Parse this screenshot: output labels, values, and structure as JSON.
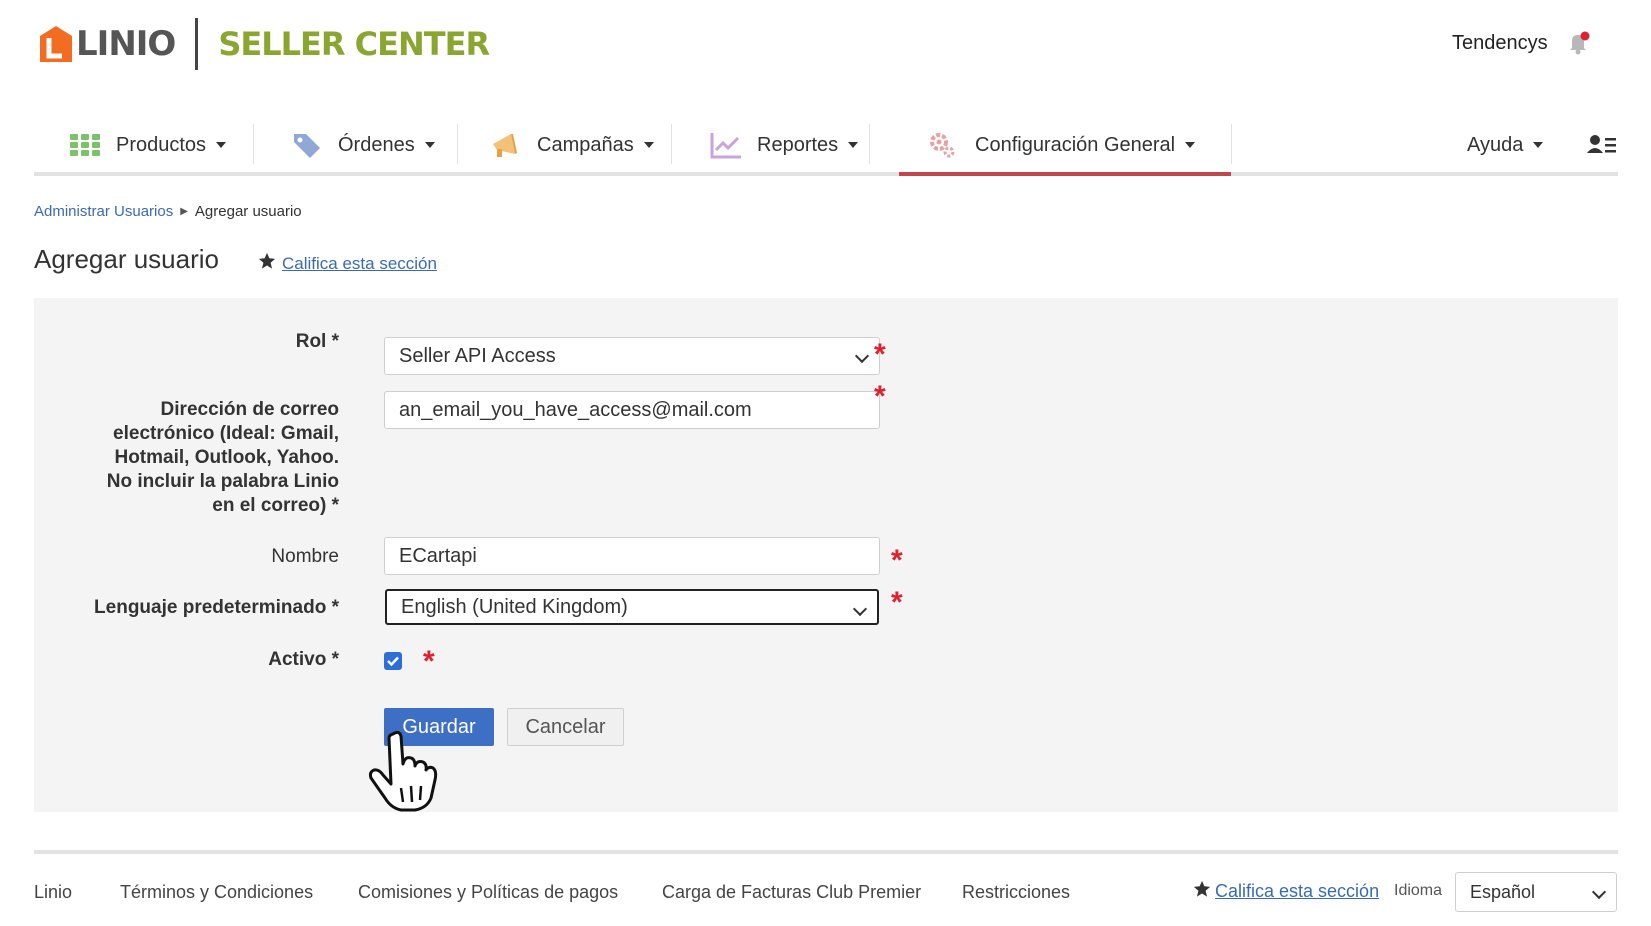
{
  "header": {
    "logo_text": "LINIO",
    "product_name": "SELLER CENTER",
    "user_name": "Tendencys",
    "brand_orange": "#f26c22",
    "brand_green": "#8ba531"
  },
  "nav": {
    "items": [
      {
        "label": "Productos",
        "icon": "grid-icon"
      },
      {
        "label": "Órdenes",
        "icon": "tag-icon"
      },
      {
        "label": "Campañas",
        "icon": "megaphone-icon"
      },
      {
        "label": "Reportes",
        "icon": "chart-icon"
      },
      {
        "label": "Configuración General",
        "icon": "gear-icon",
        "active": true
      }
    ],
    "help_label": "Ayuda",
    "active_color": "#c0474d"
  },
  "breadcrumb": {
    "parent": "Administrar Usuarios",
    "current": "Agregar usuario"
  },
  "page": {
    "title": "Agregar usuario",
    "rate_label": "Califica esta sección"
  },
  "form": {
    "role_label": "Rol *",
    "role_value": "Seller API Access",
    "email_label_lines": [
      "Dirección de correo",
      "electrónico (Ideal: Gmail,",
      "Hotmail, Outlook, Yahoo.",
      "No incluir la palabra Linio",
      "en el correo) *"
    ],
    "email_value": "an_email_you_have_access@mail.com",
    "name_label": "Nombre",
    "name_value": "ECartapi",
    "language_label": "Lenguaje predeterminado *",
    "language_value": "English (United Kingdom)",
    "active_label": "Activo *",
    "active_checked": true,
    "required_mark": "*",
    "save_label": "Guardar",
    "cancel_label": "Cancelar",
    "primary_color": "#3d6fc4"
  },
  "footer": {
    "links": [
      "Linio",
      "Términos y Condiciones",
      "Comisiones y Políticas de pagos",
      "Carga de Facturas Club Premier",
      "Restricciones"
    ],
    "rate_label": "Califica esta sección",
    "language_label": "Idioma",
    "language_value": "Español"
  }
}
